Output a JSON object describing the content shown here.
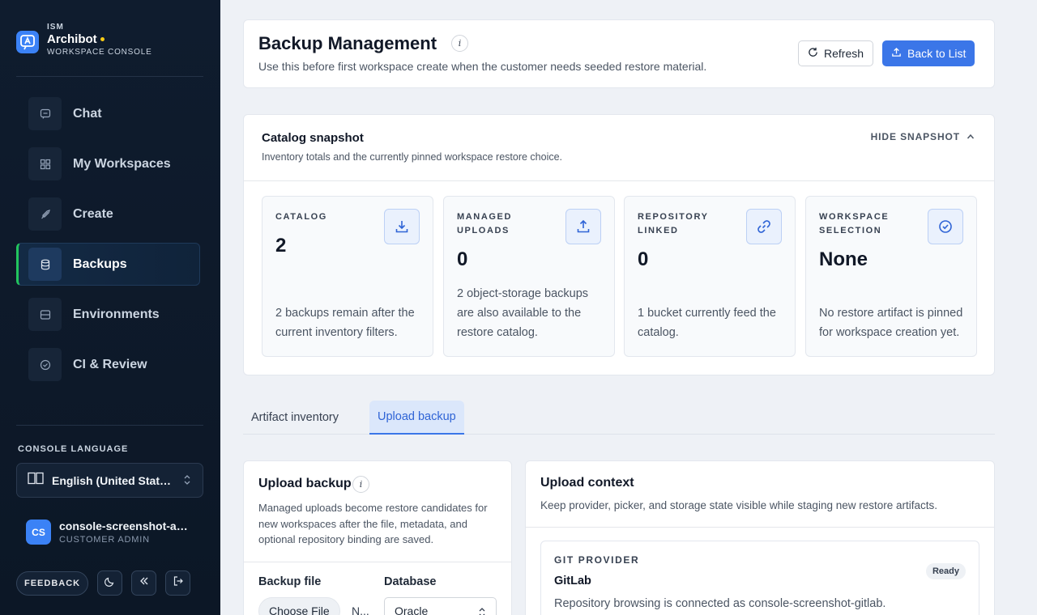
{
  "brand": {
    "org": "ISM",
    "name": "Archibot",
    "subtitle": "WORKSPACE CONSOLE"
  },
  "sidebar": {
    "items": [
      {
        "label": "Chat",
        "icon": "chat-icon",
        "active": false
      },
      {
        "label": "My Workspaces",
        "icon": "grid-icon",
        "active": false
      },
      {
        "label": "Create",
        "icon": "rocket-icon",
        "active": false
      },
      {
        "label": "Backups",
        "icon": "database-icon",
        "active": true
      },
      {
        "label": "Environments",
        "icon": "server-icon",
        "active": false
      },
      {
        "label": "CI & Review",
        "icon": "check-circle-icon",
        "active": false
      }
    ],
    "language_title": "CONSOLE LANGUAGE",
    "language_value": "English (United States)",
    "user": {
      "initials": "CS",
      "name": "console-screenshot-admin",
      "role": "CUSTOMER ADMIN"
    },
    "feedback_label": "FEEDBACK"
  },
  "header": {
    "title": "Backup Management",
    "subtitle": "Use this before first workspace create when the customer needs seeded restore material.",
    "refresh_label": "Refresh",
    "back_label": "Back to List",
    "info_glyph": "i"
  },
  "snapshot": {
    "title": "Catalog snapshot",
    "subtitle": "Inventory totals and the currently pinned workspace restore choice.",
    "toggle_label": "HIDE SNAPSHOT",
    "stats": [
      {
        "label": "CATALOG",
        "value": "2",
        "description": "2 backups remain after the current inventory filters.",
        "icon": "download-icon"
      },
      {
        "label": "MANAGED UPLOADS",
        "value": "0",
        "description": "2 object-storage backups are also available to the restore catalog.",
        "icon": "upload-icon"
      },
      {
        "label": "REPOSITORY LINKED",
        "value": "0",
        "description": "1 bucket currently feed the catalog.",
        "icon": "link-icon"
      },
      {
        "label": "WORKSPACE SELECTION",
        "value": "None",
        "description": "No restore artifact is pinned for workspace creation yet.",
        "icon": "check-circle-icon"
      }
    ]
  },
  "tabs": [
    {
      "label": "Artifact inventory",
      "active": false
    },
    {
      "label": "Upload backup",
      "active": true
    }
  ],
  "upload": {
    "title": "Upload backup",
    "description": "Managed uploads become restore candidates for new workspaces after the file, metadata, and optional repository binding are saved.",
    "file_label": "Backup file",
    "file_button": "Choose File",
    "file_status": "N...",
    "database_label": "Database",
    "database_value": "Oracle"
  },
  "context": {
    "title": "Upload context",
    "subtitle": "Keep provider, picker, and storage state visible while staging new restore artifacts.",
    "provider_label": "GIT PROVIDER",
    "provider_name": "GitLab",
    "provider_status": "Ready",
    "provider_desc": "Repository browsing is connected as console-screenshot-gitlab."
  },
  "colors": {
    "accent": "#3b76e8",
    "active_marker": "#22c55e",
    "sidebar_bg": "#0f1c2e",
    "brand_dot": "#facc15"
  }
}
